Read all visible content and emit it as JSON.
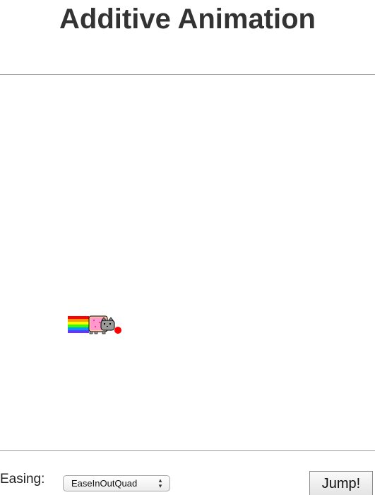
{
  "page": {
    "title": "Additive Animation"
  },
  "stage": {
    "sprite": {
      "name": "nyan-cat",
      "rainbow_colors": [
        "#ff0000",
        "#ff9900",
        "#ffff00",
        "#33ff00",
        "#0099ff",
        "#6633ff"
      ],
      "body_color": "#ff99cc",
      "head_color": "#999999",
      "ball_color": "#ff0000"
    }
  },
  "controls": {
    "easing_label": "Easing:",
    "easing_selected": "EaseInOutQuad",
    "jump_label": "Jump!"
  }
}
